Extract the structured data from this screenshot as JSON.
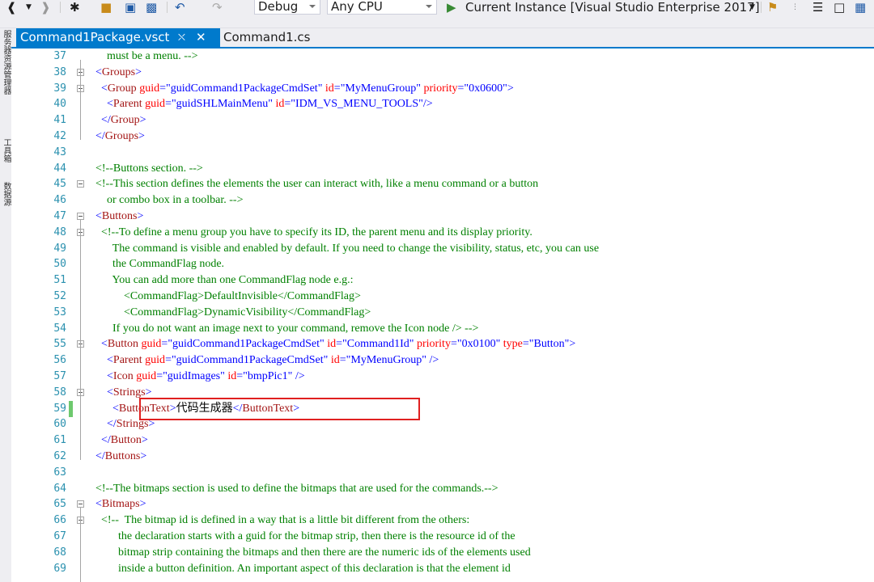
{
  "toolbar": {
    "config": "Debug",
    "platform": "Any CPU",
    "run_label": "Current Instance [Visual Studio Enterprise 2017]"
  },
  "side_tabs": [
    "服务器资源管理器",
    "工具箱",
    "数据源"
  ],
  "tabs": [
    {
      "label": "Command1Package.vsct",
      "active": true
    },
    {
      "label": "Command1.cs",
      "active": false
    }
  ],
  "editor": {
    "lines": [
      {
        "n": "37",
        "segs": [
          [
            "g",
            "        must be a menu. -->"
          ]
        ]
      },
      {
        "n": "38",
        "segs": [
          [
            "b",
            "    <"
          ],
          [
            "r",
            "Groups"
          ],
          [
            "b",
            ">"
          ]
        ]
      },
      {
        "n": "39",
        "segs": [
          [
            "b",
            "      <"
          ],
          [
            "r",
            "Group"
          ],
          [
            "a",
            " guid"
          ],
          [
            "b",
            "=\""
          ],
          [
            "b",
            "guidCommand1PackageCmdSet"
          ],
          [
            "b",
            "\""
          ],
          [
            "a",
            " id"
          ],
          [
            "b",
            "=\"MyMenuGroup\""
          ],
          [
            "a",
            " priority"
          ],
          [
            "b",
            "=\"0x0600\">"
          ]
        ]
      },
      {
        "n": "40",
        "segs": [
          [
            "b",
            "        <"
          ],
          [
            "r",
            "Parent"
          ],
          [
            "a",
            " guid"
          ],
          [
            "b",
            "=\"guidSHLMainMenu\""
          ],
          [
            "a",
            " id"
          ],
          [
            "b",
            "=\"IDM_VS_MENU_TOOLS\"/>"
          ]
        ]
      },
      {
        "n": "41",
        "segs": [
          [
            "b",
            "      </"
          ],
          [
            "r",
            "Group"
          ],
          [
            "b",
            ">"
          ]
        ]
      },
      {
        "n": "42",
        "segs": [
          [
            "b",
            "    </"
          ],
          [
            "r",
            "Groups"
          ],
          [
            "b",
            ">"
          ]
        ]
      },
      {
        "n": "43",
        "segs": [
          [
            "b",
            ""
          ]
        ]
      },
      {
        "n": "44",
        "segs": [
          [
            "g",
            "    <!--Buttons section. -->"
          ]
        ]
      },
      {
        "n": "45",
        "segs": [
          [
            "g",
            "    <!--This section defines the elements the user can interact with, like a menu command or a button"
          ]
        ]
      },
      {
        "n": "46",
        "segs": [
          [
            "g",
            "        or combo box in a toolbar. -->"
          ]
        ]
      },
      {
        "n": "47",
        "segs": [
          [
            "b",
            "    <"
          ],
          [
            "r",
            "Buttons"
          ],
          [
            "b",
            ">"
          ]
        ]
      },
      {
        "n": "48",
        "segs": [
          [
            "g",
            "      <!--To define a menu group you have to specify its ID, the parent menu and its display priority."
          ]
        ]
      },
      {
        "n": "49",
        "segs": [
          [
            "g",
            "          The command is visible and enabled by default. If you need to change the visibility, status, etc, you can use"
          ]
        ]
      },
      {
        "n": "50",
        "segs": [
          [
            "g",
            "          the CommandFlag node."
          ]
        ]
      },
      {
        "n": "51",
        "segs": [
          [
            "g",
            "          You can add more than one CommandFlag node e.g.:"
          ]
        ]
      },
      {
        "n": "52",
        "segs": [
          [
            "g",
            "              <CommandFlag>DefaultInvisible</CommandFlag>"
          ]
        ]
      },
      {
        "n": "53",
        "segs": [
          [
            "g",
            "              <CommandFlag>DynamicVisibility</CommandFlag>"
          ]
        ]
      },
      {
        "n": "54",
        "segs": [
          [
            "g",
            "          If you do not want an image next to your command, remove the Icon node /> -->"
          ]
        ]
      },
      {
        "n": "55",
        "segs": [
          [
            "b",
            "      <"
          ],
          [
            "r",
            "Button"
          ],
          [
            "a",
            " guid"
          ],
          [
            "b",
            "=\"guidCommand1PackageCmdSet\""
          ],
          [
            "a",
            " id"
          ],
          [
            "b",
            "=\"Command1Id\""
          ],
          [
            "a",
            " priority"
          ],
          [
            "b",
            "=\"0x0100\""
          ],
          [
            "a",
            " type"
          ],
          [
            "b",
            "=\"Button\">"
          ]
        ]
      },
      {
        "n": "56",
        "segs": [
          [
            "b",
            "        <"
          ],
          [
            "r",
            "Parent"
          ],
          [
            "a",
            " guid"
          ],
          [
            "b",
            "=\"guidCommand1PackageCmdSet\""
          ],
          [
            "a",
            " id"
          ],
          [
            "b",
            "=\"MyMenuGroup\" />"
          ]
        ]
      },
      {
        "n": "57",
        "segs": [
          [
            "b",
            "        <"
          ],
          [
            "r",
            "Icon"
          ],
          [
            "a",
            " guid"
          ],
          [
            "b",
            "=\"guidImages\""
          ],
          [
            "a",
            " id"
          ],
          [
            "b",
            "=\"bmpPic1\" />"
          ]
        ]
      },
      {
        "n": "58",
        "segs": [
          [
            "b",
            "        <"
          ],
          [
            "r",
            "Strings"
          ],
          [
            "b",
            ">"
          ]
        ]
      },
      {
        "n": "59",
        "segs": [
          [
            "b",
            "          <"
          ],
          [
            "r",
            "ButtonText"
          ],
          [
            "b",
            ">"
          ],
          [
            "k",
            "代码生成器"
          ],
          [
            "b",
            "</"
          ],
          [
            "r",
            "ButtonText"
          ],
          [
            "b",
            ">"
          ]
        ]
      },
      {
        "n": "60",
        "segs": [
          [
            "b",
            "        </"
          ],
          [
            "r",
            "Strings"
          ],
          [
            "b",
            ">"
          ]
        ]
      },
      {
        "n": "61",
        "segs": [
          [
            "b",
            "      </"
          ],
          [
            "r",
            "Button"
          ],
          [
            "b",
            ">"
          ]
        ]
      },
      {
        "n": "62",
        "segs": [
          [
            "b",
            "    </"
          ],
          [
            "r",
            "Buttons"
          ],
          [
            "b",
            ">"
          ]
        ]
      },
      {
        "n": "63",
        "segs": [
          [
            "b",
            ""
          ]
        ]
      },
      {
        "n": "64",
        "segs": [
          [
            "g",
            "    <!--The bitmaps section is used to define the bitmaps that are used for the commands.-->"
          ]
        ]
      },
      {
        "n": "65",
        "segs": [
          [
            "b",
            "    <"
          ],
          [
            "r",
            "Bitmaps"
          ],
          [
            "b",
            ">"
          ]
        ]
      },
      {
        "n": "66",
        "segs": [
          [
            "g",
            "      <!--  The bitmap id is defined in a way that is a little bit different from the others:"
          ]
        ]
      },
      {
        "n": "67",
        "segs": [
          [
            "g",
            "            the declaration starts with a guid for the bitmap strip, then there is the resource id of the"
          ]
        ]
      },
      {
        "n": "68",
        "segs": [
          [
            "g",
            "            bitmap strip containing the bitmaps and then there are the numeric ids of the elements used"
          ]
        ]
      },
      {
        "n": "69",
        "segs": [
          [
            "g",
            "            inside a button definition. An important aspect of this declaration is that the element id"
          ]
        ]
      }
    ]
  }
}
